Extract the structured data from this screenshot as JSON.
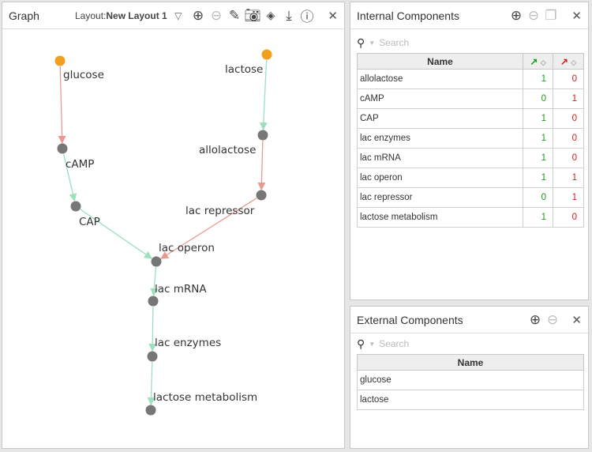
{
  "graph": {
    "title": "Graph",
    "layout_label": "Layout:",
    "layout_value": "New Layout 1",
    "icons": [
      "add-icon",
      "remove-icon",
      "edit-icon",
      "camera-icon",
      "hide-icon",
      "download-icon",
      "info-icon",
      "close-icon"
    ],
    "nodes": [
      {
        "name": "glucose",
        "type": "external"
      },
      {
        "name": "lactose",
        "type": "external"
      },
      {
        "name": "cAMP",
        "type": "internal"
      },
      {
        "name": "allolactose",
        "type": "internal"
      },
      {
        "name": "CAP",
        "type": "internal"
      },
      {
        "name": "lac repressor",
        "type": "internal"
      },
      {
        "name": "lac operon",
        "type": "internal"
      },
      {
        "name": "lac mRNA",
        "type": "internal"
      },
      {
        "name": "lac enzymes",
        "type": "internal"
      },
      {
        "name": "lactose metabolism",
        "type": "internal"
      }
    ],
    "edges": [
      {
        "from": "glucose",
        "to": "cAMP",
        "sign": "negative"
      },
      {
        "from": "cAMP",
        "to": "CAP",
        "sign": "positive"
      },
      {
        "from": "CAP",
        "to": "lac operon",
        "sign": "positive"
      },
      {
        "from": "lactose",
        "to": "allolactose",
        "sign": "positive"
      },
      {
        "from": "allolactose",
        "to": "lac repressor",
        "sign": "negative"
      },
      {
        "from": "lac repressor",
        "to": "lac operon",
        "sign": "negative"
      },
      {
        "from": "lac operon",
        "to": "lac mRNA",
        "sign": "positive"
      },
      {
        "from": "lac mRNA",
        "to": "lac enzymes",
        "sign": "positive"
      },
      {
        "from": "lac enzymes",
        "to": "lactose metabolism",
        "sign": "positive"
      }
    ],
    "colors": {
      "external": "#f0a020",
      "internal": "#777777",
      "positive": "#9de0bd",
      "negative": "#e89a90"
    }
  },
  "internal": {
    "title": "Internal Components",
    "search_placeholder": "Search",
    "col_name": "Name",
    "rows": [
      {
        "name": "allolactose",
        "pos": "1",
        "neg": "0"
      },
      {
        "name": "cAMP",
        "pos": "0",
        "neg": "1"
      },
      {
        "name": "CAP",
        "pos": "1",
        "neg": "0"
      },
      {
        "name": "lac enzymes",
        "pos": "1",
        "neg": "0"
      },
      {
        "name": "lac mRNA",
        "pos": "1",
        "neg": "0"
      },
      {
        "name": "lac operon",
        "pos": "1",
        "neg": "1"
      },
      {
        "name": "lac repressor",
        "pos": "0",
        "neg": "1"
      },
      {
        "name": "lactose metabolism",
        "pos": "1",
        "neg": "0"
      }
    ]
  },
  "external": {
    "title": "External Components",
    "search_placeholder": "Search",
    "col_name": "Name",
    "rows": [
      {
        "name": "glucose"
      },
      {
        "name": "lactose"
      }
    ]
  }
}
